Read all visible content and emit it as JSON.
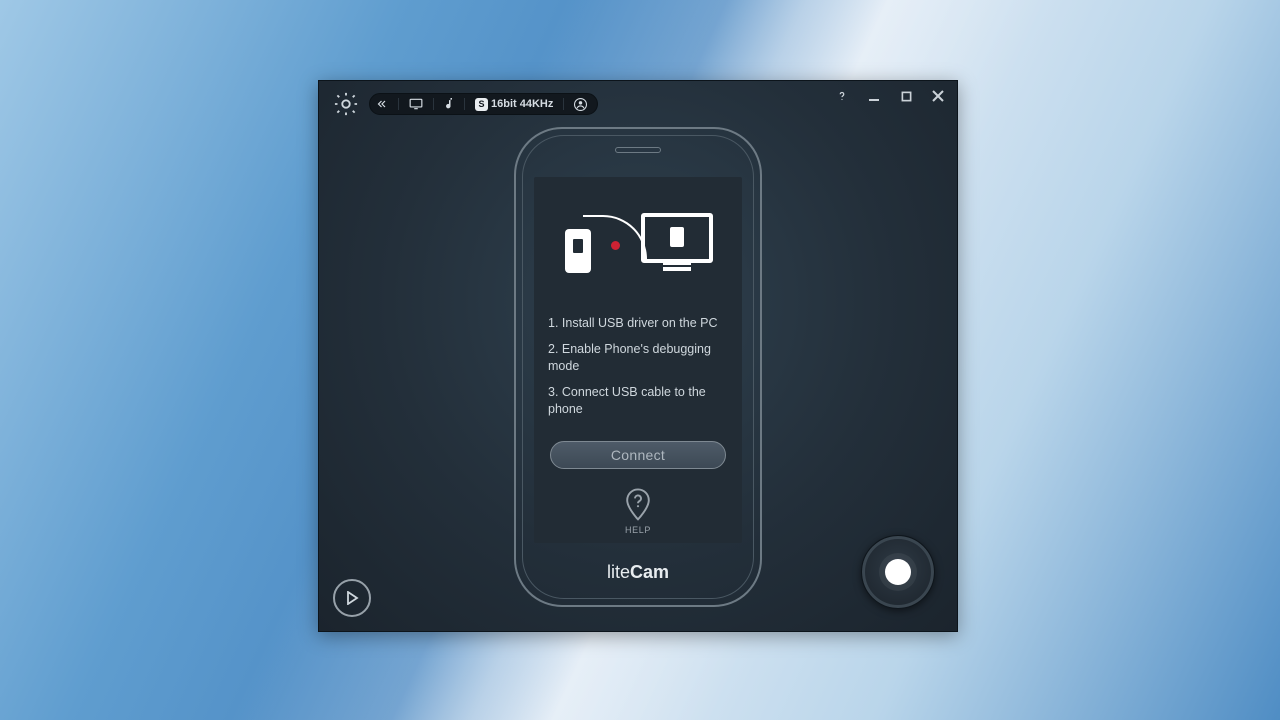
{
  "toolbar": {
    "audio_format": "16bit 44KHz",
    "s_badge": "S"
  },
  "instructions": {
    "step1": "1. Install USB driver on the PC",
    "step2": "2. Enable Phone's debugging mode",
    "step3": "3. Connect USB cable to the phone"
  },
  "buttons": {
    "connect": "Connect"
  },
  "help": {
    "label": "HELP"
  },
  "brand": {
    "name_light": "lite",
    "name_bold": "Cam"
  }
}
